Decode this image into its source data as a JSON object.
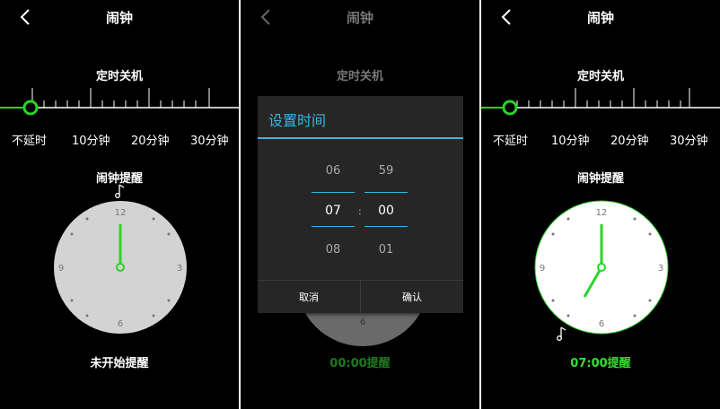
{
  "screens": [
    {
      "title": "闹钟",
      "shutdown_label": "定时关机",
      "ticks": [
        "不延时",
        "10分钟",
        "20分钟",
        "30分钟"
      ],
      "reminder_label": "闹钟提醒",
      "status": "未开始提醒",
      "clock_numbers": [
        "12",
        "3",
        "6",
        "9"
      ],
      "clock_time": "00:00"
    },
    {
      "title": "闹钟",
      "shutdown_label": "定时关机",
      "status": "00:00提醒",
      "clock_numbers": [
        "6"
      ]
    },
    {
      "title": "闹钟",
      "shutdown_label": "定时关机",
      "ticks": [
        "不延时",
        "10分钟",
        "20分钟",
        "30分钟"
      ],
      "reminder_label": "闹钟提醒",
      "status": "07:00提醒",
      "clock_numbers": [
        "12",
        "3",
        "6",
        "9"
      ],
      "clock_time": "07:00"
    }
  ],
  "dialog": {
    "title": "设置时间",
    "hours": [
      "06",
      "07",
      "08"
    ],
    "minutes": [
      "59",
      "00",
      "01"
    ],
    "colon": ":",
    "cancel": "取消",
    "confirm": "确认"
  },
  "colors": {
    "accent_green": "#2bd42b",
    "dialog_blue": "#35b6e0",
    "clock_face": "#d3d3d3",
    "status_green": "#33e033",
    "status_dim_green": "#1d7a1d"
  },
  "icons": [
    "back-arrow-icon",
    "music-note-icon"
  ]
}
